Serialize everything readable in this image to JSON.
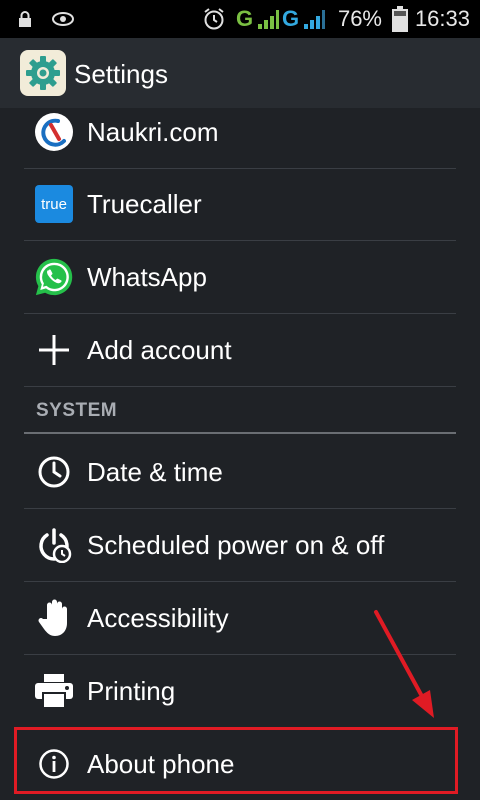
{
  "status_bar": {
    "time": "16:33",
    "battery": "76%",
    "network_1": "G",
    "network_2": "G",
    "icons": [
      "lock-icon",
      "eye-icon",
      "alarm-icon",
      "signal-icon",
      "battery-icon"
    ]
  },
  "action_bar": {
    "title": "Settings",
    "icon": "settings-gear-icon"
  },
  "accounts": [
    {
      "label": "Naukri.com",
      "icon": "naukri-icon"
    },
    {
      "label": "Truecaller",
      "icon": "truecaller-icon",
      "icon_text": "true"
    },
    {
      "label": "WhatsApp",
      "icon": "whatsapp-icon"
    },
    {
      "label": "Add account",
      "icon": "plus-icon"
    }
  ],
  "system": {
    "header": "SYSTEM",
    "items": [
      {
        "label": "Date & time",
        "icon": "clock-icon"
      },
      {
        "label": "Scheduled power on & off",
        "icon": "power-schedule-icon"
      },
      {
        "label": "Accessibility",
        "icon": "hand-icon"
      },
      {
        "label": "Printing",
        "icon": "printer-icon"
      },
      {
        "label": "About phone",
        "icon": "info-icon"
      }
    ]
  },
  "colors": {
    "accent_green": "#7bc043",
    "highlight_red": "#e01b24",
    "truecaller_blue": "#1b8ae0",
    "whatsapp_green": "#25c04a"
  }
}
